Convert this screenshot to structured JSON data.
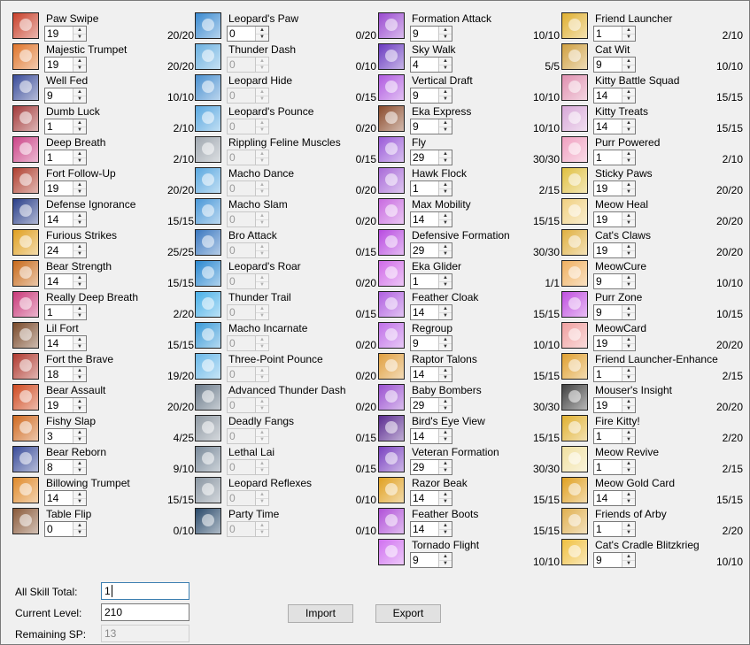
{
  "columns": [
    [
      {
        "name": "Paw Swipe",
        "value": "19",
        "level": "20/20",
        "enabled": true,
        "icon": "bear-paw-icon",
        "color": "#c9402a"
      },
      {
        "name": "Majestic Trumpet",
        "value": "19",
        "level": "20/20",
        "enabled": true,
        "icon": "bear-trumpet-icon",
        "color": "#e0752a"
      },
      {
        "name": "Well Fed",
        "value": "9",
        "level": "10/10",
        "enabled": true,
        "icon": "bear-food-icon",
        "color": "#3a4c9a"
      },
      {
        "name": "Dumb Luck",
        "value": "1",
        "level": "2/10",
        "enabled": true,
        "icon": "bear-luck-icon",
        "color": "#a33a3a"
      },
      {
        "name": "Deep Breath",
        "value": "1",
        "level": "2/10",
        "enabled": true,
        "icon": "bear-breath-icon",
        "color": "#cc4488"
      },
      {
        "name": "Fort Follow-Up",
        "value": "19",
        "level": "20/20",
        "enabled": true,
        "icon": "bear-fort-icon",
        "color": "#b04030"
      },
      {
        "name": "Defense Ignorance",
        "value": "14",
        "level": "15/15",
        "enabled": true,
        "icon": "bear-defense-icon",
        "color": "#2a3f8a"
      },
      {
        "name": "Furious Strikes",
        "value": "24",
        "level": "25/25",
        "enabled": true,
        "icon": "bear-strikes-icon",
        "color": "#e0a020"
      },
      {
        "name": "Bear Strength",
        "value": "14",
        "level": "15/15",
        "enabled": true,
        "icon": "bear-strength-icon",
        "color": "#c86a1a"
      },
      {
        "name": "Really Deep Breath",
        "value": "1",
        "level": "2/20",
        "enabled": true,
        "icon": "bear-deep-breath-icon",
        "color": "#c93a7a"
      },
      {
        "name": "Lil Fort",
        "value": "14",
        "level": "15/15",
        "enabled": true,
        "icon": "bear-lil-fort-icon",
        "color": "#7a4a2a"
      },
      {
        "name": "Fort the Brave",
        "value": "18",
        "level": "19/20",
        "enabled": true,
        "icon": "bear-brave-icon",
        "color": "#b03a30"
      },
      {
        "name": "Bear Assault",
        "value": "19",
        "level": "20/20",
        "enabled": true,
        "icon": "bear-assault-icon",
        "color": "#d04a20"
      },
      {
        "name": "Fishy Slap",
        "value": "3",
        "level": "4/25",
        "enabled": true,
        "icon": "bear-fish-icon",
        "color": "#d06a20"
      },
      {
        "name": "Bear Reborn",
        "value": "8",
        "level": "9/10",
        "enabled": true,
        "icon": "bear-reborn-icon",
        "color": "#3a4c9a"
      },
      {
        "name": "Billowing Trumpet",
        "value": "14",
        "level": "15/15",
        "enabled": true,
        "icon": "bear-billow-icon",
        "color": "#e08a2a"
      },
      {
        "name": "Table Flip",
        "value": "0",
        "level": "0/10",
        "enabled": true,
        "icon": "bear-table-icon",
        "color": "#8a5a3a"
      }
    ],
    [
      {
        "name": "Leopard's Paw",
        "value": "0",
        "level": "0/20",
        "enabled": true,
        "icon": "leopard-paw-icon",
        "color": "#3a8ad0"
      },
      {
        "name": "Thunder Dash",
        "value": "0",
        "level": "0/10",
        "enabled": false,
        "icon": "thunder-dash-icon",
        "color": "#6ab0e0"
      },
      {
        "name": "Leopard Hide",
        "value": "0",
        "level": "0/15",
        "enabled": false,
        "icon": "leopard-hide-icon",
        "color": "#4a90d0"
      },
      {
        "name": "Leopard's Pounce",
        "value": "0",
        "level": "0/20",
        "enabled": false,
        "icon": "leopard-pounce-icon",
        "color": "#5aa8e0"
      },
      {
        "name": "Rippling Feline Muscles",
        "value": "0",
        "level": "0/15",
        "enabled": false,
        "icon": "feline-muscles-icon",
        "color": "#a0a8b0"
      },
      {
        "name": "Macho Dance",
        "value": "0",
        "level": "0/20",
        "enabled": false,
        "icon": "macho-dance-icon",
        "color": "#5aa8e0"
      },
      {
        "name": "Macho Slam",
        "value": "0",
        "level": "0/20",
        "enabled": false,
        "icon": "macho-slam-icon",
        "color": "#4a98d8"
      },
      {
        "name": "Bro Attack",
        "value": "0",
        "level": "0/15",
        "enabled": false,
        "icon": "bro-attack-icon",
        "color": "#3a78c0"
      },
      {
        "name": "Leopard's Roar",
        "value": "0",
        "level": "0/20",
        "enabled": false,
        "icon": "leopard-roar-icon",
        "color": "#2a88d0"
      },
      {
        "name": "Thunder Trail",
        "value": "0",
        "level": "0/15",
        "enabled": false,
        "icon": "thunder-trail-icon",
        "color": "#4ab0e8"
      },
      {
        "name": "Macho Incarnate",
        "value": "0",
        "level": "0/20",
        "enabled": false,
        "icon": "macho-incarnate-icon",
        "color": "#3a9ad8"
      },
      {
        "name": "Three-Point Pounce",
        "value": "0",
        "level": "0/20",
        "enabled": false,
        "icon": "three-point-pounce-icon",
        "color": "#6ab8e8"
      },
      {
        "name": "Advanced Thunder Dash",
        "value": "0",
        "level": "0/20",
        "enabled": false,
        "icon": "advanced-thunder-dash-icon",
        "color": "#6a7a8a"
      },
      {
        "name": "Deadly Fangs",
        "value": "0",
        "level": "0/15",
        "enabled": false,
        "icon": "deadly-fangs-icon",
        "color": "#909aa4"
      },
      {
        "name": "Lethal Lai",
        "value": "0",
        "level": "0/15",
        "enabled": false,
        "icon": "lethal-lai-icon",
        "color": "#7a8a9a"
      },
      {
        "name": "Leopard Reflexes",
        "value": "0",
        "level": "0/10",
        "enabled": false,
        "icon": "leopard-reflexes-icon",
        "color": "#8a96a2"
      },
      {
        "name": "Party Time",
        "value": "0",
        "level": "0/10",
        "enabled": false,
        "icon": "party-time-icon",
        "color": "#2a4a6a"
      }
    ],
    [
      {
        "name": "Formation Attack",
        "value": "9",
        "level": "10/10",
        "enabled": true,
        "icon": "formation-attack-icon",
        "color": "#9a4ad0"
      },
      {
        "name": "Sky Walk",
        "value": "4",
        "level": "5/5",
        "enabled": true,
        "icon": "sky-walk-icon",
        "color": "#6a3ac0"
      },
      {
        "name": "Vertical Draft",
        "value": "9",
        "level": "10/10",
        "enabled": true,
        "icon": "vertical-draft-icon",
        "color": "#b05ae0"
      },
      {
        "name": "Eka Express",
        "value": "9",
        "level": "10/10",
        "enabled": true,
        "icon": "eka-express-icon",
        "color": "#8a4a2a"
      },
      {
        "name": "Fly",
        "value": "29",
        "level": "30/30",
        "enabled": true,
        "icon": "fly-icon",
        "color": "#9a5ad8"
      },
      {
        "name": "Hawk Flock",
        "value": "1",
        "level": "2/15",
        "enabled": true,
        "icon": "hawk-flock-icon",
        "color": "#a86ad8"
      },
      {
        "name": "Max Mobility",
        "value": "14",
        "level": "15/15",
        "enabled": true,
        "icon": "max-mobility-icon",
        "color": "#c86ae0"
      },
      {
        "name": "Defensive Formation",
        "value": "29",
        "level": "30/30",
        "enabled": true,
        "icon": "defensive-formation-icon",
        "color": "#b84ae0"
      },
      {
        "name": "Eka Glider",
        "value": "1",
        "level": "1/1",
        "enabled": true,
        "icon": "eka-glider-icon",
        "color": "#d06ae8"
      },
      {
        "name": "Feather Cloak",
        "value": "14",
        "level": "15/15",
        "enabled": true,
        "icon": "feather-cloak-icon",
        "color": "#b060e0"
      },
      {
        "name": "Regroup",
        "value": "9",
        "level": "10/10",
        "enabled": true,
        "icon": "regroup-icon",
        "color": "#c070e8"
      },
      {
        "name": "Raptor Talons",
        "value": "14",
        "level": "15/15",
        "enabled": true,
        "icon": "raptor-talons-icon",
        "color": "#e0a040"
      },
      {
        "name": "Baby Bombers",
        "value": "29",
        "level": "30/30",
        "enabled": true,
        "icon": "baby-bombers-icon",
        "color": "#9a50d0"
      },
      {
        "name": "Bird's Eye View",
        "value": "14",
        "level": "15/15",
        "enabled": true,
        "icon": "birds-eye-view-icon",
        "color": "#5a2a90"
      },
      {
        "name": "Veteran Formation",
        "value": "29",
        "level": "30/30",
        "enabled": true,
        "icon": "veteran-formation-icon",
        "color": "#7a40c0"
      },
      {
        "name": "Razor Beak",
        "value": "14",
        "level": "15/15",
        "enabled": true,
        "icon": "razor-beak-icon",
        "color": "#e0a020"
      },
      {
        "name": "Feather Boots",
        "value": "14",
        "level": "15/15",
        "enabled": true,
        "icon": "feather-boots-icon",
        "color": "#b050d8"
      },
      {
        "name": "Tornado Flight",
        "value": "9",
        "level": "10/10",
        "enabled": true,
        "icon": "tornado-flight-icon",
        "color": "#d070f0"
      }
    ],
    [
      {
        "name": "Friend Launcher",
        "value": "1",
        "level": "2/10",
        "enabled": true,
        "icon": "friend-launcher-icon",
        "color": "#e0b030"
      },
      {
        "name": "Cat Wit",
        "value": "9",
        "level": "10/10",
        "enabled": true,
        "icon": "cat-wit-icon",
        "color": "#d0a040"
      },
      {
        "name": "Kitty Battle Squad",
        "value": "14",
        "level": "15/15",
        "enabled": true,
        "icon": "kitty-battle-squad-icon",
        "color": "#e090b0"
      },
      {
        "name": "Kitty Treats",
        "value": "14",
        "level": "15/15",
        "enabled": true,
        "icon": "kitty-treats-icon",
        "color": "#d8a8d8"
      },
      {
        "name": "Purr Powered",
        "value": "1",
        "level": "2/10",
        "enabled": true,
        "icon": "purr-powered-icon",
        "color": "#f0a0c0"
      },
      {
        "name": "Sticky Paws",
        "value": "19",
        "level": "20/20",
        "enabled": true,
        "icon": "sticky-paws-icon",
        "color": "#e0c040"
      },
      {
        "name": "Meow Heal",
        "value": "19",
        "level": "20/20",
        "enabled": true,
        "icon": "meow-heal-icon",
        "color": "#f0d080"
      },
      {
        "name": "Cat's Claws",
        "value": "19",
        "level": "20/20",
        "enabled": true,
        "icon": "cats-claws-icon",
        "color": "#e0b040"
      },
      {
        "name": "MeowCure",
        "value": "9",
        "level": "10/10",
        "enabled": true,
        "icon": "meowcure-icon",
        "color": "#f0b060"
      },
      {
        "name": "Purr Zone",
        "value": "9",
        "level": "10/15",
        "enabled": true,
        "icon": "purr-zone-icon",
        "color": "#c050e0"
      },
      {
        "name": "MeowCard",
        "value": "19",
        "level": "20/20",
        "enabled": true,
        "icon": "meowcard-icon",
        "color": "#f0a0a0"
      },
      {
        "name": "Friend Launcher-Enhance",
        "value": "1",
        "level": "2/15",
        "enabled": true,
        "icon": "friend-launcher-enhance-icon",
        "color": "#e0a030"
      },
      {
        "name": "Mouser's Insight",
        "value": "19",
        "level": "20/20",
        "enabled": true,
        "icon": "mousers-insight-icon",
        "color": "#404040"
      },
      {
        "name": "Fire Kitty!",
        "value": "1",
        "level": "2/20",
        "enabled": true,
        "icon": "fire-kitty-icon",
        "color": "#e0b030"
      },
      {
        "name": "Meow Revive",
        "value": "1",
        "level": "2/15",
        "enabled": true,
        "icon": "meow-revive-icon",
        "color": "#f0e0a0"
      },
      {
        "name": "Meow Gold Card",
        "value": "14",
        "level": "15/15",
        "enabled": true,
        "icon": "meow-gold-card-icon",
        "color": "#e0a020"
      },
      {
        "name": "Friends of Arby",
        "value": "1",
        "level": "2/20",
        "enabled": true,
        "icon": "friends-of-arby-icon",
        "color": "#e0b050"
      },
      {
        "name": "Cat's Cradle Blitzkrieg",
        "value": "9",
        "level": "10/10",
        "enabled": true,
        "icon": "cats-cradle-blitzkrieg-icon",
        "color": "#f0c040"
      }
    ]
  ],
  "form": {
    "all_skill_total_label": "All Skill Total:",
    "all_skill_total_value": "1",
    "current_level_label": "Current Level:",
    "current_level_value": "210",
    "remaining_sp_label": "Remaining SP:",
    "remaining_sp_value": "13"
  },
  "buttons": {
    "import_label": "Import",
    "export_label": "Export"
  },
  "icons": {
    "spin_up": "▲",
    "spin_down": "▼"
  }
}
